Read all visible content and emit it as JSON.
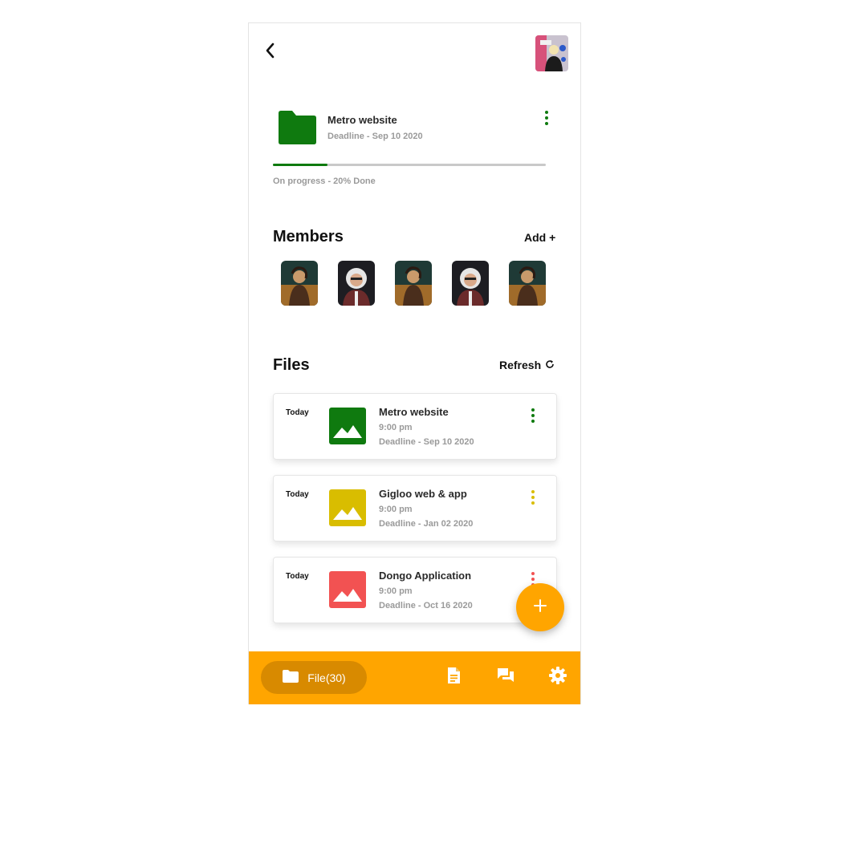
{
  "project": {
    "title": "Metro website",
    "deadline": "Deadline - Sep 10 2020",
    "progress_text": "On progress - 20% Done",
    "progress_fraction": 0.2,
    "folder_color": "#0f7a0f"
  },
  "members_section": {
    "title": "Members",
    "action_label": "Add +",
    "members": [
      {
        "name": "member-1",
        "photo": "woman-photo"
      },
      {
        "name": "member-2",
        "photo": "man-photo"
      },
      {
        "name": "member-3",
        "photo": "woman-photo"
      },
      {
        "name": "member-4",
        "photo": "man-photo"
      },
      {
        "name": "member-5",
        "photo": "woman-photo"
      }
    ]
  },
  "files_section": {
    "title": "Files",
    "action_label": "Refresh",
    "action_icon": "refresh-icon",
    "files": [
      {
        "day": "Today",
        "title": "Metro website",
        "time": "9:00 pm",
        "deadline": "Deadline - Sep 10 2020",
        "color": "#0f7a0f"
      },
      {
        "day": "Today",
        "title": "Gigloo web & app",
        "time": "9:00 pm",
        "deadline": "Deadline - Jan 02 2020",
        "color": "#d9bd00"
      },
      {
        "day": "Today",
        "title": "Dongo Application",
        "time": "9:00 pm",
        "deadline": "Deadline - Oct 16 2020",
        "color": "#f25252"
      }
    ]
  },
  "fab": {
    "icon": "plus-icon"
  },
  "bottom_nav": {
    "file_label": "File(30)",
    "file_icon": "folder-icon",
    "icons": [
      "document-icon",
      "chat-icon",
      "settings-icon"
    ],
    "bar_color": "#ffa500"
  }
}
